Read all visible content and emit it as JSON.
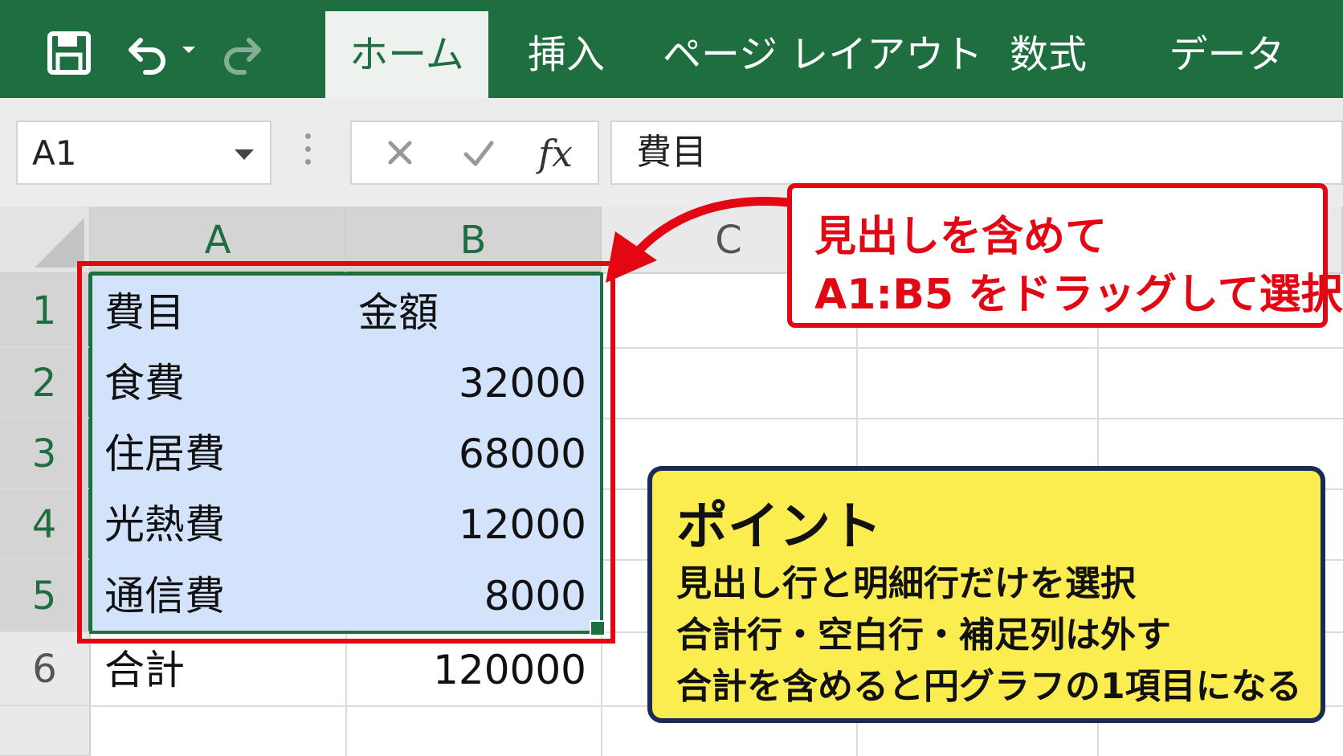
{
  "ribbon": {
    "tabs": [
      {
        "label": "ホーム",
        "active": true
      },
      {
        "label": "挿入",
        "active": false
      },
      {
        "label": "ページ レイアウト",
        "active": false
      },
      {
        "label": "数式",
        "active": false
      },
      {
        "label": "データ",
        "active": false
      }
    ],
    "quick_access_icons": [
      "save-icon",
      "undo-icon",
      "undo-dropdown-icon",
      "redo-icon"
    ]
  },
  "formula_bar": {
    "name_box": "A1",
    "cancel_icon": "x-icon",
    "enter_icon": "check-icon",
    "fx_label": "fx",
    "content": "費目"
  },
  "sheet": {
    "columns": [
      "A",
      "B",
      "C"
    ],
    "rows": [
      "1",
      "2",
      "3",
      "4",
      "5",
      "6"
    ],
    "cells": [
      {
        "a": "費目",
        "b": "金額"
      },
      {
        "a": "食費",
        "b": "32000"
      },
      {
        "a": "住居費",
        "b": "68000"
      },
      {
        "a": "光熱費",
        "b": "12000"
      },
      {
        "a": "通信費",
        "b": "8000"
      },
      {
        "a": "合計",
        "b": "120000"
      }
    ],
    "selection": "A1:B5",
    "selection_color": "#1e6e3f",
    "highlight_color": "#e30613"
  },
  "callout_red": {
    "line1": "見出しを含めて",
    "line2": "A1:B5 をドラッグして選択"
  },
  "callout_yellow": {
    "title": "ポイント",
    "lines": [
      "見出し行と明細行だけを選択",
      "合計行・空白行・補足列は外す",
      "合計を含めると円グラフの1項目になる"
    ]
  }
}
